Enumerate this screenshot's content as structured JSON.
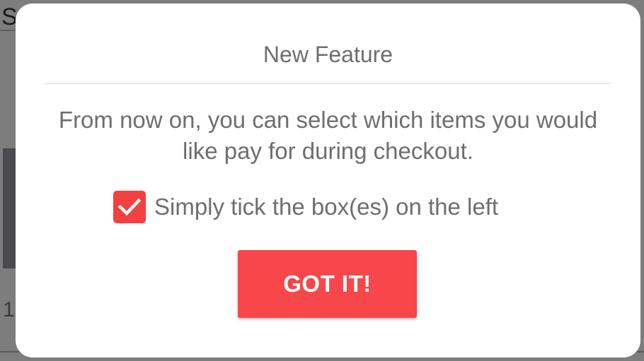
{
  "background": {
    "header_text": "S",
    "number_text": "1"
  },
  "dialog": {
    "title": "New Feature",
    "message": "From now on, you can select which items you would like pay for during checkout.",
    "tick_label": "Simply tick the box(es) on the left",
    "tick_checked": true,
    "button_label": "GOT IT!"
  },
  "colors": {
    "accent": "#f7474a",
    "text_gray": "#6e6e6e",
    "dialog_bg": "#ffffff",
    "overlay": "#7d7d7d"
  },
  "icons": {
    "checkbox": "checkmark-icon"
  }
}
